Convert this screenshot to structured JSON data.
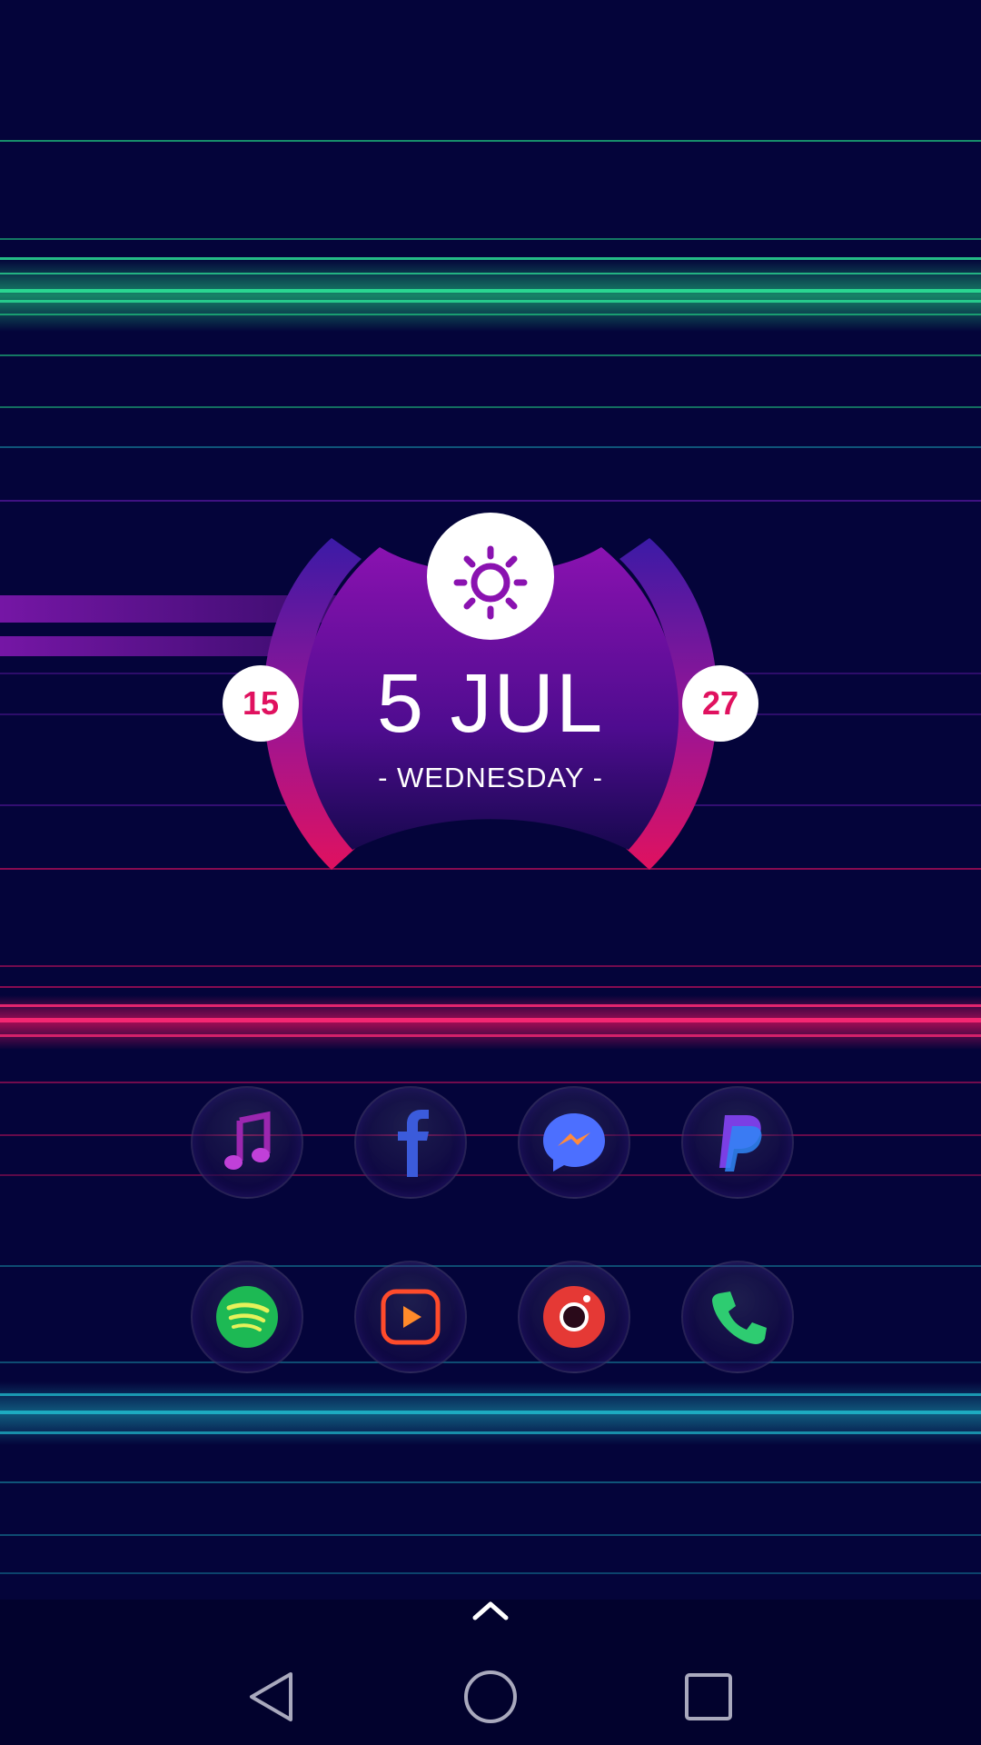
{
  "widget": {
    "weather_icon": "sun-icon",
    "date": "5 JUL",
    "day": "- WEDNESDAY -",
    "temp_low": "15",
    "temp_high": "27"
  },
  "apps": [
    {
      "icon": "music-icon",
      "color": "#9c27b0"
    },
    {
      "icon": "facebook-icon",
      "color": "#3b5bdb"
    },
    {
      "icon": "messenger-icon",
      "color": "#4c6fff"
    },
    {
      "icon": "paypal-icon",
      "color": "#7b3fe4"
    },
    {
      "icon": "spotify-icon",
      "color": "#1db954"
    },
    {
      "icon": "video-player-icon",
      "color": "#ff6a2a"
    },
    {
      "icon": "camera-icon",
      "color": "#e53935"
    },
    {
      "icon": "phone-icon",
      "color": "#2ecc71"
    }
  ],
  "colors": {
    "background": "#04043a",
    "accent_magenta": "#e0115f",
    "accent_purple": "#8a12b0",
    "accent_green": "#22d28a",
    "accent_teal": "#1aa3b8"
  },
  "app_drawer": {
    "icon": "chevron-up-icon"
  },
  "navigation": {
    "back": "back-triangle-icon",
    "home": "home-circle-icon",
    "recents": "recents-square-icon"
  }
}
